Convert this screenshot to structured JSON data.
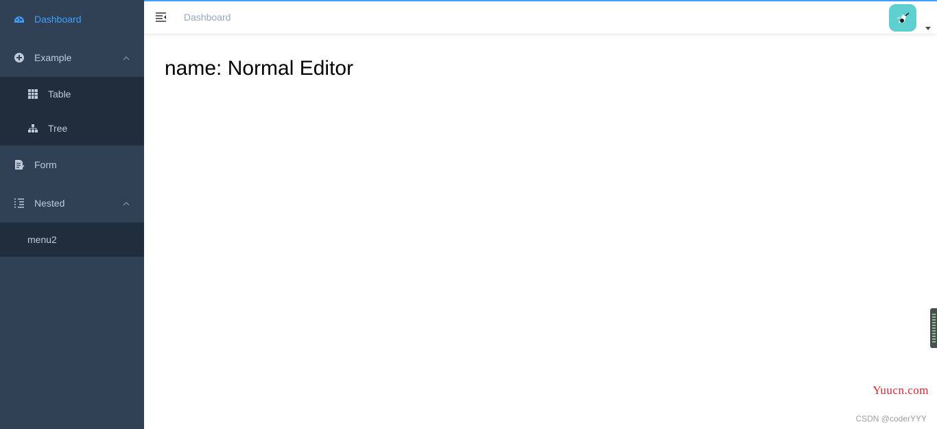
{
  "sidebar": {
    "items": [
      {
        "label": "Dashboard",
        "icon": "dashboard-icon",
        "active": true
      },
      {
        "label": "Example",
        "icon": "example-icon",
        "expanded": true,
        "children": [
          {
            "label": "Table",
            "icon": "table-icon"
          },
          {
            "label": "Tree",
            "icon": "tree-icon"
          }
        ]
      },
      {
        "label": "Form",
        "icon": "form-icon"
      },
      {
        "label": "Nested",
        "icon": "nested-icon",
        "expanded": true,
        "children": [
          {
            "label": "menu2"
          }
        ]
      }
    ]
  },
  "navbar": {
    "hamburger_icon": "hamburger-icon",
    "breadcrumb": "Dashboard",
    "avatar_icon": "avatar-icon",
    "dropdown_icon": "caret-down-icon"
  },
  "main": {
    "title": "name: Normal Editor"
  },
  "watermark": {
    "site": "Yuucn.com",
    "author": "CSDN @coderYYY"
  },
  "colors": {
    "sidebar_bg": "#304156",
    "submenu_bg": "#1f2d3d",
    "menu_text": "#bfcbd9",
    "active_text": "#409eff",
    "breadcrumb_text": "#97a8be",
    "avatar_bg": "#5fd0d0",
    "watermark_site": "#d4262f"
  }
}
